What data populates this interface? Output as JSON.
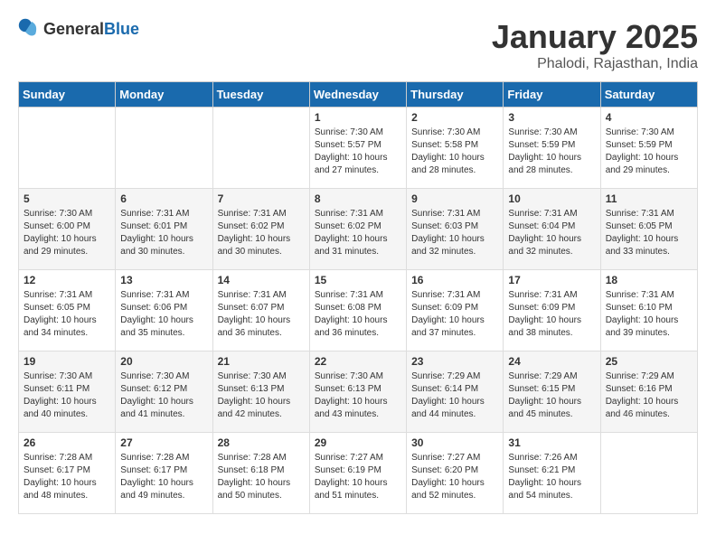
{
  "logo": {
    "general": "General",
    "blue": "Blue"
  },
  "header": {
    "title": "January 2025",
    "subtitle": "Phalodi, Rajasthan, India"
  },
  "weekdays": [
    "Sunday",
    "Monday",
    "Tuesday",
    "Wednesday",
    "Thursday",
    "Friday",
    "Saturday"
  ],
  "weeks": [
    [
      {
        "day": "",
        "info": ""
      },
      {
        "day": "",
        "info": ""
      },
      {
        "day": "",
        "info": ""
      },
      {
        "day": "1",
        "info": "Sunrise: 7:30 AM\nSunset: 5:57 PM\nDaylight: 10 hours\nand 27 minutes."
      },
      {
        "day": "2",
        "info": "Sunrise: 7:30 AM\nSunset: 5:58 PM\nDaylight: 10 hours\nand 28 minutes."
      },
      {
        "day": "3",
        "info": "Sunrise: 7:30 AM\nSunset: 5:59 PM\nDaylight: 10 hours\nand 28 minutes."
      },
      {
        "day": "4",
        "info": "Sunrise: 7:30 AM\nSunset: 5:59 PM\nDaylight: 10 hours\nand 29 minutes."
      }
    ],
    [
      {
        "day": "5",
        "info": "Sunrise: 7:30 AM\nSunset: 6:00 PM\nDaylight: 10 hours\nand 29 minutes."
      },
      {
        "day": "6",
        "info": "Sunrise: 7:31 AM\nSunset: 6:01 PM\nDaylight: 10 hours\nand 30 minutes."
      },
      {
        "day": "7",
        "info": "Sunrise: 7:31 AM\nSunset: 6:02 PM\nDaylight: 10 hours\nand 30 minutes."
      },
      {
        "day": "8",
        "info": "Sunrise: 7:31 AM\nSunset: 6:02 PM\nDaylight: 10 hours\nand 31 minutes."
      },
      {
        "day": "9",
        "info": "Sunrise: 7:31 AM\nSunset: 6:03 PM\nDaylight: 10 hours\nand 32 minutes."
      },
      {
        "day": "10",
        "info": "Sunrise: 7:31 AM\nSunset: 6:04 PM\nDaylight: 10 hours\nand 32 minutes."
      },
      {
        "day": "11",
        "info": "Sunrise: 7:31 AM\nSunset: 6:05 PM\nDaylight: 10 hours\nand 33 minutes."
      }
    ],
    [
      {
        "day": "12",
        "info": "Sunrise: 7:31 AM\nSunset: 6:05 PM\nDaylight: 10 hours\nand 34 minutes."
      },
      {
        "day": "13",
        "info": "Sunrise: 7:31 AM\nSunset: 6:06 PM\nDaylight: 10 hours\nand 35 minutes."
      },
      {
        "day": "14",
        "info": "Sunrise: 7:31 AM\nSunset: 6:07 PM\nDaylight: 10 hours\nand 36 minutes."
      },
      {
        "day": "15",
        "info": "Sunrise: 7:31 AM\nSunset: 6:08 PM\nDaylight: 10 hours\nand 36 minutes."
      },
      {
        "day": "16",
        "info": "Sunrise: 7:31 AM\nSunset: 6:09 PM\nDaylight: 10 hours\nand 37 minutes."
      },
      {
        "day": "17",
        "info": "Sunrise: 7:31 AM\nSunset: 6:09 PM\nDaylight: 10 hours\nand 38 minutes."
      },
      {
        "day": "18",
        "info": "Sunrise: 7:31 AM\nSunset: 6:10 PM\nDaylight: 10 hours\nand 39 minutes."
      }
    ],
    [
      {
        "day": "19",
        "info": "Sunrise: 7:30 AM\nSunset: 6:11 PM\nDaylight: 10 hours\nand 40 minutes."
      },
      {
        "day": "20",
        "info": "Sunrise: 7:30 AM\nSunset: 6:12 PM\nDaylight: 10 hours\nand 41 minutes."
      },
      {
        "day": "21",
        "info": "Sunrise: 7:30 AM\nSunset: 6:13 PM\nDaylight: 10 hours\nand 42 minutes."
      },
      {
        "day": "22",
        "info": "Sunrise: 7:30 AM\nSunset: 6:13 PM\nDaylight: 10 hours\nand 43 minutes."
      },
      {
        "day": "23",
        "info": "Sunrise: 7:29 AM\nSunset: 6:14 PM\nDaylight: 10 hours\nand 44 minutes."
      },
      {
        "day": "24",
        "info": "Sunrise: 7:29 AM\nSunset: 6:15 PM\nDaylight: 10 hours\nand 45 minutes."
      },
      {
        "day": "25",
        "info": "Sunrise: 7:29 AM\nSunset: 6:16 PM\nDaylight: 10 hours\nand 46 minutes."
      }
    ],
    [
      {
        "day": "26",
        "info": "Sunrise: 7:28 AM\nSunset: 6:17 PM\nDaylight: 10 hours\nand 48 minutes."
      },
      {
        "day": "27",
        "info": "Sunrise: 7:28 AM\nSunset: 6:17 PM\nDaylight: 10 hours\nand 49 minutes."
      },
      {
        "day": "28",
        "info": "Sunrise: 7:28 AM\nSunset: 6:18 PM\nDaylight: 10 hours\nand 50 minutes."
      },
      {
        "day": "29",
        "info": "Sunrise: 7:27 AM\nSunset: 6:19 PM\nDaylight: 10 hours\nand 51 minutes."
      },
      {
        "day": "30",
        "info": "Sunrise: 7:27 AM\nSunset: 6:20 PM\nDaylight: 10 hours\nand 52 minutes."
      },
      {
        "day": "31",
        "info": "Sunrise: 7:26 AM\nSunset: 6:21 PM\nDaylight: 10 hours\nand 54 minutes."
      },
      {
        "day": "",
        "info": ""
      }
    ]
  ]
}
